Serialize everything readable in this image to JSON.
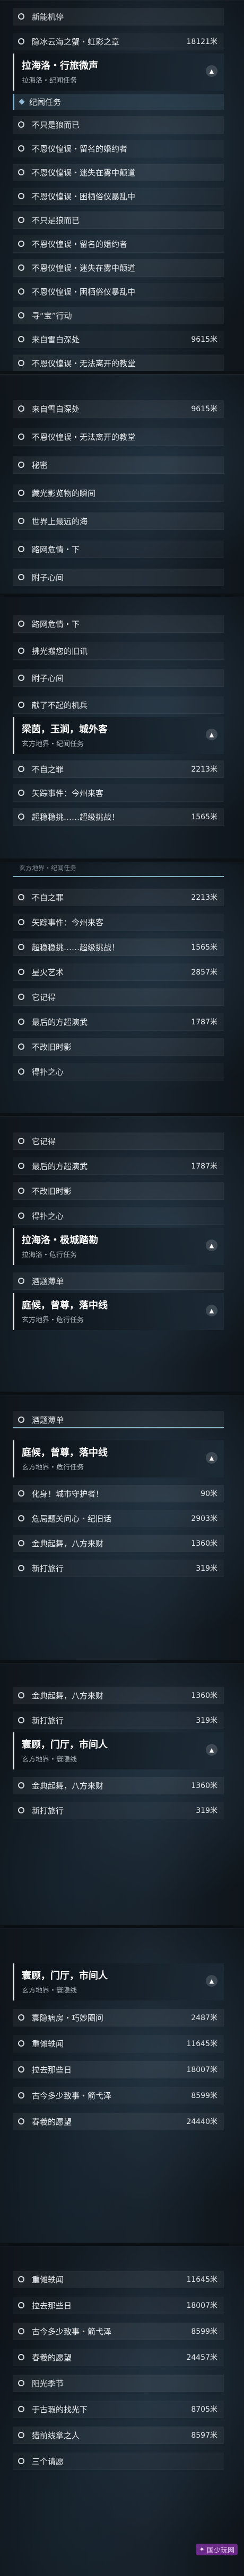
{
  "panel1": {
    "rows_top": [
      {
        "label": "新能机停",
        "dist": ""
      },
      {
        "label": "隐冰云海之蟹・虹彩之章",
        "dist": "18121米"
      }
    ],
    "header": {
      "title": "拉海洛・行旅微声",
      "sub": "拉海洛・纪闻任务"
    },
    "category": "纪闻任务",
    "rows": [
      {
        "label": "不只是狼而已",
        "dist": ""
      },
      {
        "label": "不恩仪惶误・留名的婚约者",
        "dist": ""
      },
      {
        "label": "不恩仪惶误・迷失在雾中颠道",
        "dist": ""
      },
      {
        "label": "不恩仪惶误・困栖俗仪暴乱中",
        "dist": ""
      },
      {
        "label": "不只是狼而已",
        "dist": ""
      },
      {
        "label": "不恩仪惶误・留名的婚约者",
        "dist": ""
      },
      {
        "label": "不恩仪惶误・迷失在雾中颠道",
        "dist": ""
      },
      {
        "label": "不恩仪惶误・困栖俗仪暴乱中",
        "dist": ""
      },
      {
        "label": "寻“宝”行动",
        "dist": ""
      },
      {
        "label": "来自雪白深处",
        "dist": "9615米"
      },
      {
        "label": "不恩仪惶误・无法离开的教堂",
        "dist": ""
      },
      {
        "label": "秘密",
        "dist": ""
      }
    ]
  },
  "panel2": {
    "rows": [
      {
        "label": "来自雪白深处",
        "dist": "9615米"
      },
      {
        "label": "不恩仪惶误・无法离开的教堂",
        "dist": ""
      },
      {
        "label": "秘密",
        "dist": ""
      },
      {
        "label": "藏光影览物的瞬间",
        "dist": ""
      },
      {
        "label": "世界上最远的海",
        "dist": ""
      },
      {
        "label": "路网危情・下",
        "dist": ""
      },
      {
        "label": "附子心间",
        "dist": ""
      }
    ]
  },
  "panel3": {
    "rows": [
      {
        "label": "路网危情・下",
        "dist": ""
      },
      {
        "label": "拂光搬您的旧讯",
        "dist": ""
      },
      {
        "label": "附子心间",
        "dist": ""
      },
      {
        "label": "献了不起的机兵",
        "dist": ""
      }
    ],
    "header": {
      "title": "梁茵，玉涧，城外客",
      "sub": "玄方地界・纪闻任务"
    },
    "rows2": [
      {
        "label": "不自之罪",
        "dist": "2213米"
      },
      {
        "label": "矢踪事件：今州来客",
        "dist": ""
      },
      {
        "label": "超稳稳挑……超级挑战！",
        "dist": "1565米"
      }
    ]
  },
  "panel4": {
    "hint": "玄方地界・纪闻任务",
    "rows": [
      {
        "label": "不自之罪",
        "dist": "2213米"
      },
      {
        "label": "矢踪事件：今州来客",
        "dist": ""
      },
      {
        "label": "超稳稳挑……超级挑战！",
        "dist": "1565米"
      },
      {
        "label": "星火艺术",
        "dist": "2857米"
      },
      {
        "label": "它记得",
        "dist": ""
      },
      {
        "label": "最后的方超演武",
        "dist": "1787米"
      },
      {
        "label": "不改旧时影",
        "dist": ""
      },
      {
        "label": "得扑之心",
        "dist": ""
      }
    ]
  },
  "panel5": {
    "rows": [
      {
        "label": "它记得",
        "dist": ""
      },
      {
        "label": "最后的方超演武",
        "dist": "1787米"
      },
      {
        "label": "不改旧时影",
        "dist": ""
      },
      {
        "label": "得扑之心",
        "dist": ""
      }
    ],
    "header": {
      "title": "拉海洛・极城踏勘",
      "sub": "拉海洛・危行任务"
    },
    "rows2": [
      {
        "label": "酒题薄单",
        "dist": ""
      }
    ],
    "header2": {
      "title": "庭候，曾尊，落中线",
      "sub": "玄方地界・危行任务"
    }
  },
  "panel6": {
    "rows": [
      {
        "label": "酒题薄单",
        "dist": ""
      }
    ],
    "header": {
      "title": "庭候，曾尊，落中线",
      "sub": "玄方地界・危行任务"
    },
    "rows2": [
      {
        "label": "化身！城市守护者！",
        "dist": "90米"
      },
      {
        "label": "危局题关问心・纪旧话",
        "dist": "2903米"
      },
      {
        "label": "金典起舞，八方来财",
        "dist": "1360米"
      },
      {
        "label": "新打旅行",
        "dist": "319米"
      }
    ]
  },
  "panel7": {
    "rows": [
      {
        "label": "金典起舞，八方来财",
        "dist": "1360米"
      },
      {
        "label": "新打旅行",
        "dist": "319米"
      }
    ],
    "header": {
      "title": "寰顾，门厅，市间人",
      "sub": "玄方地界・寰隐线"
    },
    "rows2": [
      {
        "label": "金典起舞，八方来财",
        "dist": "1360米"
      },
      {
        "label": "新打旅行",
        "dist": "319米"
      }
    ]
  },
  "panel8": {
    "header": {
      "title": "寰顾，门厅，市间人",
      "sub": "玄方地界・寰隐线"
    },
    "rows": [
      {
        "label": "寰隐病房・巧妙圈问",
        "dist": "2487米"
      },
      {
        "label": "重傩轶闻",
        "dist": "11645米"
      },
      {
        "label": "拉去那些日",
        "dist": "18007米"
      },
      {
        "label": "古今多少致事・箭弋泽",
        "dist": "8599米"
      },
      {
        "label": "春羲的愿望",
        "dist": "24440米"
      }
    ]
  },
  "panel9": {
    "rows": [
      {
        "label": "重傩轶闻",
        "dist": "11645米"
      },
      {
        "label": "拉去那些日",
        "dist": "18007米"
      },
      {
        "label": "古今多少致事・箭弋泽",
        "dist": "8599米"
      },
      {
        "label": "春羲的愿望",
        "dist": "24457米"
      },
      {
        "label": "阳光季节",
        "dist": ""
      },
      {
        "label": "于古瑕的找光下",
        "dist": "8705米"
      },
      {
        "label": "猎前线拿之人",
        "dist": "8597米"
      },
      {
        "label": "三个请愿",
        "dist": ""
      }
    ]
  },
  "watermark": "国少玩网"
}
